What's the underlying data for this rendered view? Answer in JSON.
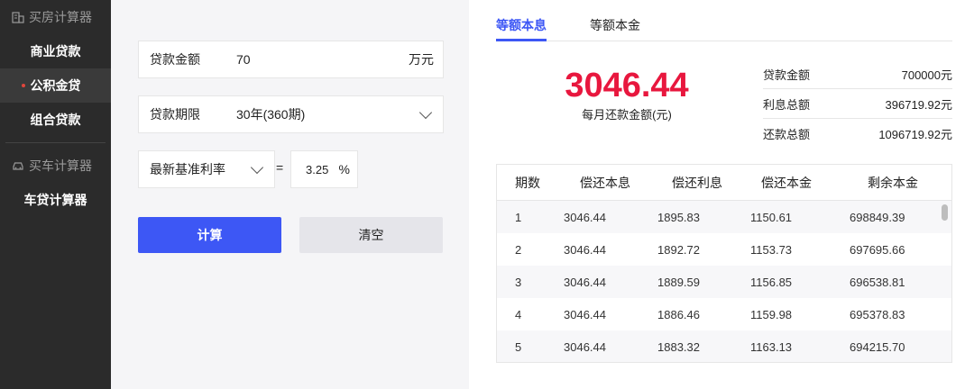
{
  "sidebar": {
    "section_house": "买房计算器",
    "items_house": [
      {
        "label": "商业贷款"
      },
      {
        "label": "公积金贷"
      },
      {
        "label": "组合贷款"
      }
    ],
    "section_car": "买车计算器",
    "items_car": [
      {
        "label": "车贷计算器"
      }
    ]
  },
  "form": {
    "amount": {
      "label": "贷款金额",
      "value": "70",
      "unit": "万元"
    },
    "term": {
      "label": "贷款期限",
      "value": "30年(360期)"
    },
    "rate": {
      "label": "最新基准利率",
      "equals": "=",
      "value": "3.25",
      "unit": "%"
    },
    "calc_button": "计算",
    "clear_button": "清空"
  },
  "result": {
    "tabs": [
      {
        "label": "等额本息"
      },
      {
        "label": "等额本金"
      }
    ],
    "monthly_payment": "3046.44",
    "monthly_label": "每月还款金额(元)",
    "summary": [
      {
        "label": "贷款金额",
        "value": "700000元"
      },
      {
        "label": "利息总额",
        "value": "396719.92元"
      },
      {
        "label": "还款总额",
        "value": "1096719.92元"
      }
    ],
    "table": {
      "headers": [
        "期数",
        "偿还本息",
        "偿还利息",
        "偿还本金",
        "剩余本金"
      ],
      "rows": [
        [
          "1",
          "3046.44",
          "1895.83",
          "1150.61",
          "698849.39"
        ],
        [
          "2",
          "3046.44",
          "1892.72",
          "1153.73",
          "697695.66"
        ],
        [
          "3",
          "3046.44",
          "1889.59",
          "1156.85",
          "696538.81"
        ],
        [
          "4",
          "3046.44",
          "1886.46",
          "1159.98",
          "695378.83"
        ],
        [
          "5",
          "3046.44",
          "1883.32",
          "1163.13",
          "694215.70"
        ]
      ]
    }
  },
  "colors": {
    "accent": "#3d57f5",
    "amount_red": "#e8173e",
    "sidebar_bg": "#2b2b2b"
  }
}
